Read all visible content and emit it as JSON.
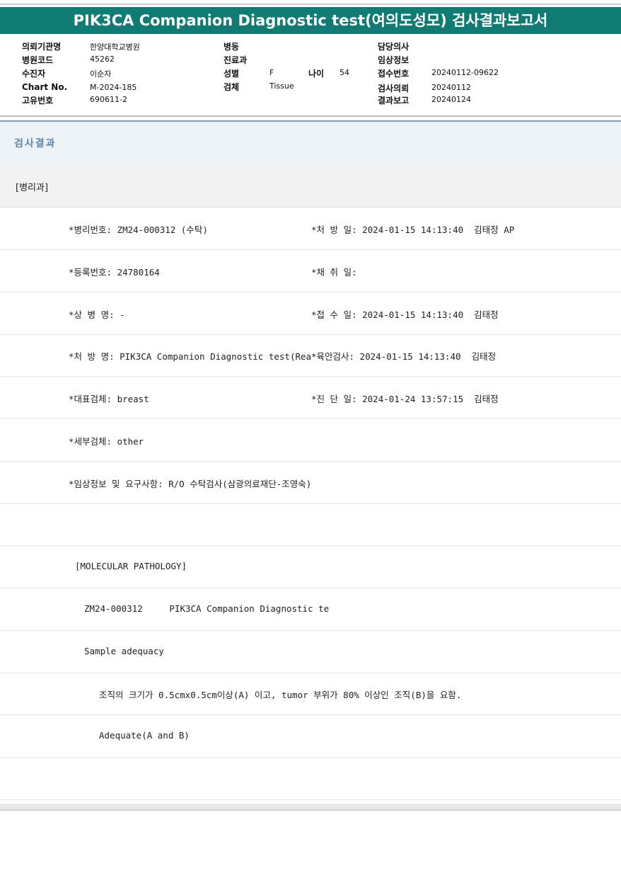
{
  "title": "PIK3CA Companion Diagnostic test(여의도성모) 검사결과보고서",
  "patient_info": {
    "institution_label": "의뢰기관명",
    "institution": "한양대학교병원",
    "hospital_code_label": "병원코드",
    "hospital_code": "45262",
    "examinee_label": "수진자",
    "examinee": "이순자",
    "chart_label": "Chart No.",
    "chart_no": "M-2024-185",
    "unique_label": "고유번호",
    "unique_no": "690611-2",
    "ward_label": "병동",
    "dept_label": "진료과",
    "sex_label": "성별",
    "sex": "F",
    "age_label": "나이",
    "age": "54",
    "specimen_label": "검체",
    "specimen": "Tissue",
    "doctor_label": "담당의사",
    "clinical_label": "임상정보",
    "receipt_label": "접수번호",
    "receipt_no": "20240112-09622",
    "request_label": "검사의뢰",
    "request_date": "20240112",
    "report_label": "결과보고",
    "report_date": "20240124"
  },
  "results_header": "검사결과",
  "department": "[병리과]",
  "rows": [
    {
      "left": "*병리번호: ZM24-000312 (수탁)",
      "right": "*처 방 일: 2024-01-15 14:13:40  김태정 AP"
    },
    {
      "left": "*등록번호: 24780164",
      "right": "*채 취 일:"
    },
    {
      "left": "*상 병 명: -",
      "right": "*접 수 일: 2024-01-15 14:13:40  김태정"
    },
    {
      "left": "*처 방 명: PIK3CA Companion Diagnostic test(Rea",
      "right": "*육안검사: 2024-01-15 14:13:40  김태정"
    },
    {
      "left": "*대표검체: breast",
      "right": "*진 단 일: 2024-01-24 13:57:15  김태정"
    },
    {
      "left": "*세부검체: other",
      "right": ""
    },
    {
      "left": "*임상정보 및 요구사항: R/O 수탁검사(삼광의료재단-조영숙)",
      "right": ""
    },
    {
      "left": "",
      "right": ""
    },
    {
      "left": "[MOLECULAR PATHOLOGY]",
      "right": ""
    },
    {
      "left": "ZM24-000312     PIK3CA Companion Diagnostic te",
      "right": ""
    },
    {
      "left": "Sample adequacy",
      "right": ""
    },
    {
      "left": "조직의 크기가 0.5cmx0.5cm이상(A) 이고, tumor 부위가 80% 이상인 조직(B)을 요함.",
      "right": ""
    },
    {
      "left": "Adequate(A and B)",
      "right": ""
    },
    {
      "left": "",
      "right": ""
    }
  ]
}
